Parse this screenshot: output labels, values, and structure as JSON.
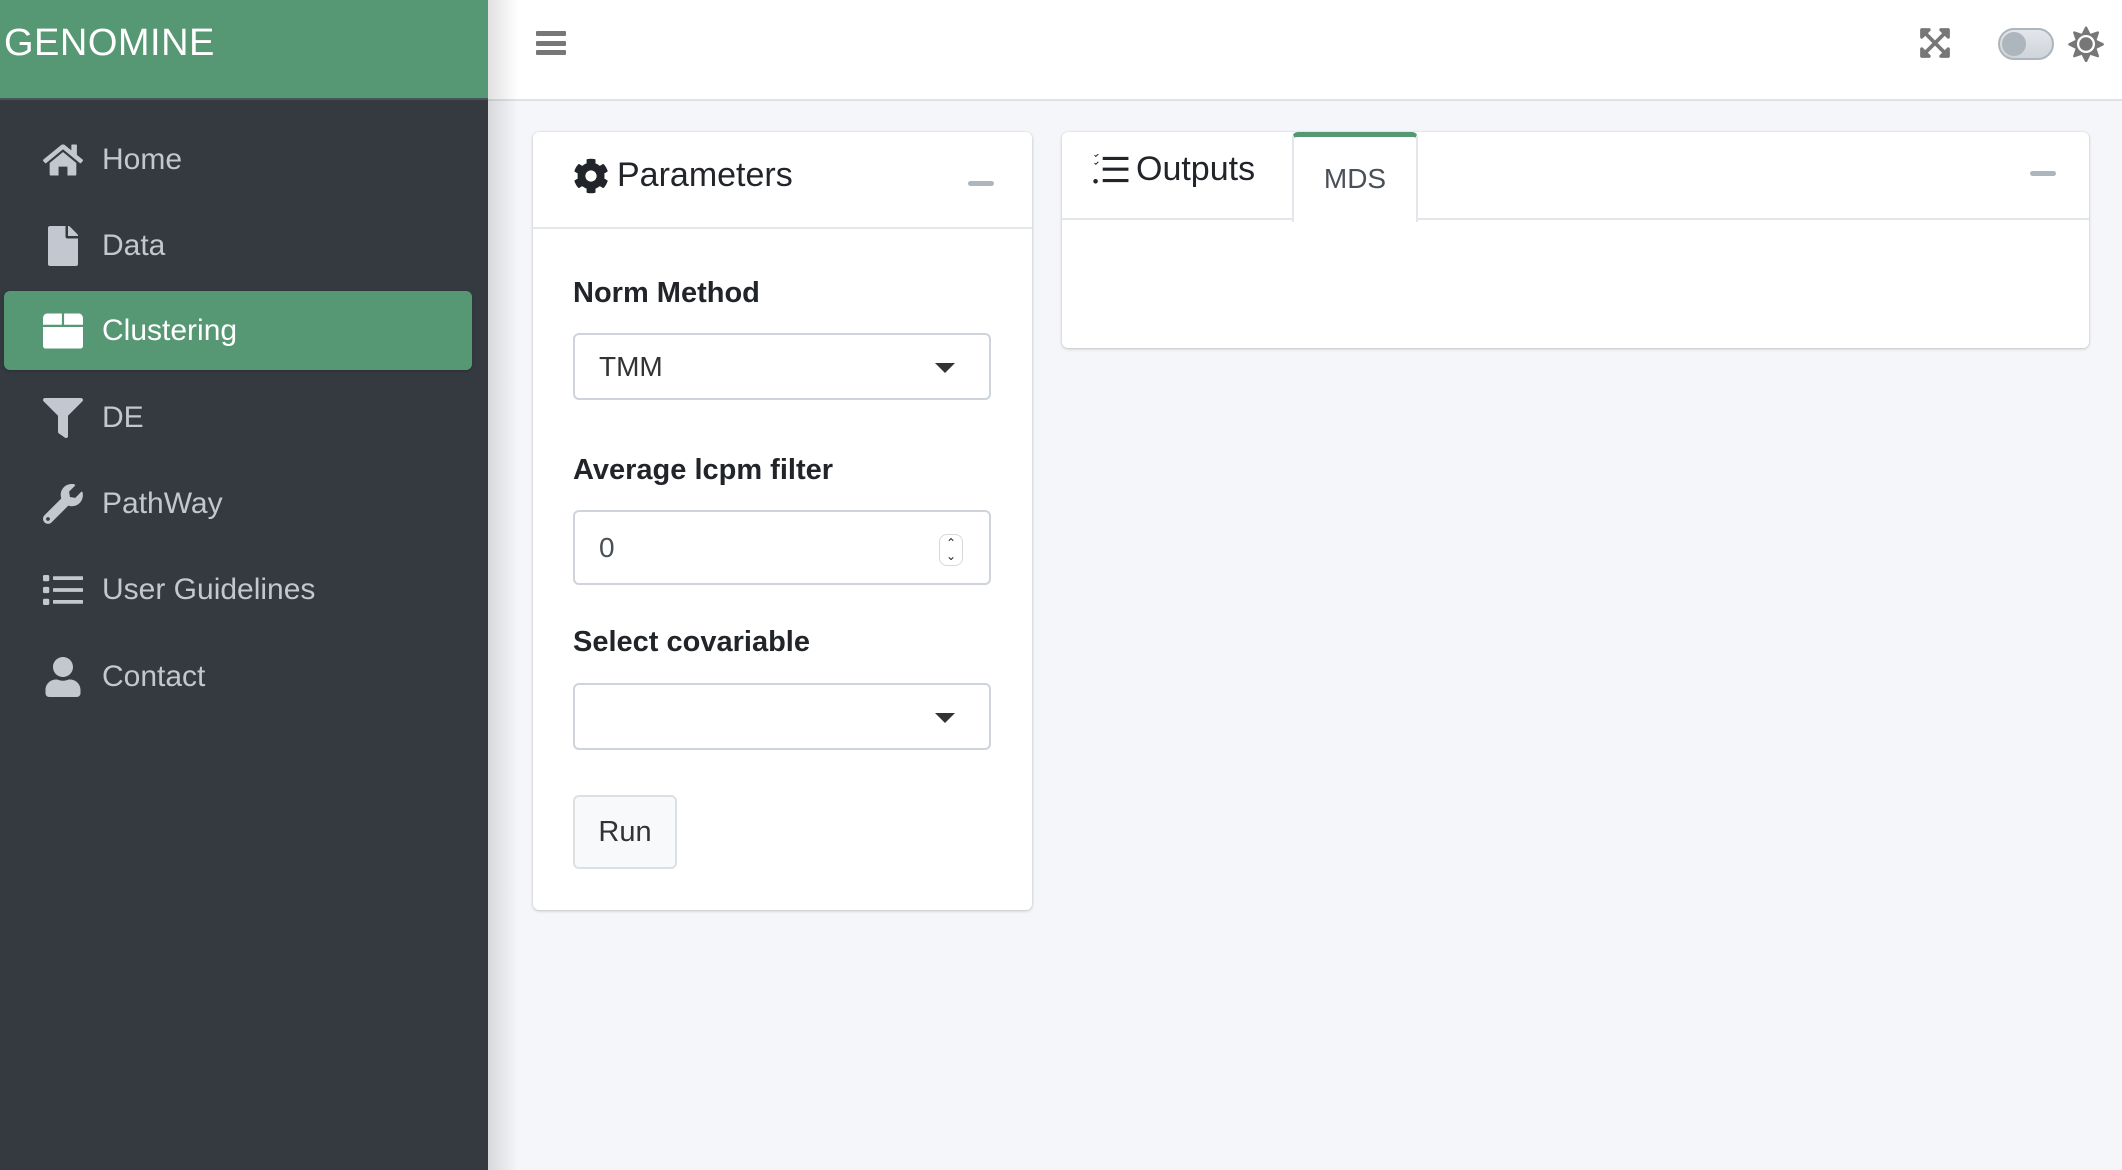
{
  "brand": {
    "title": "GENOMINE",
    "accent_color": "#579874"
  },
  "sidebar": {
    "items": [
      {
        "label": "Home",
        "icon": "home-icon",
        "active": false
      },
      {
        "label": "Data",
        "icon": "file-icon",
        "active": false
      },
      {
        "label": "Clustering",
        "icon": "box-icon",
        "active": true
      },
      {
        "label": "DE",
        "icon": "filter-icon",
        "active": false
      },
      {
        "label": "PathWay",
        "icon": "wrench-icon",
        "active": false
      },
      {
        "label": "User Guidelines",
        "icon": "list-icon",
        "active": false
      },
      {
        "label": "Contact",
        "icon": "user-icon",
        "active": false
      }
    ]
  },
  "topbar": {
    "menu_icon": "hamburger-icon",
    "fullscreen_icon": "expand-icon",
    "theme_toggle": {
      "state": "off"
    },
    "theme_icon": "sun-icon"
  },
  "parameters": {
    "title": "Parameters",
    "norm_method": {
      "label": "Norm Method",
      "value": "TMM"
    },
    "lcpm_filter": {
      "label": "Average lcpm filter",
      "value": "0"
    },
    "covariable": {
      "label": "Select covariable",
      "value": ""
    },
    "run_label": "Run"
  },
  "outputs": {
    "title": "Outputs",
    "tabs": [
      {
        "label": "MDS",
        "active": true
      }
    ]
  }
}
